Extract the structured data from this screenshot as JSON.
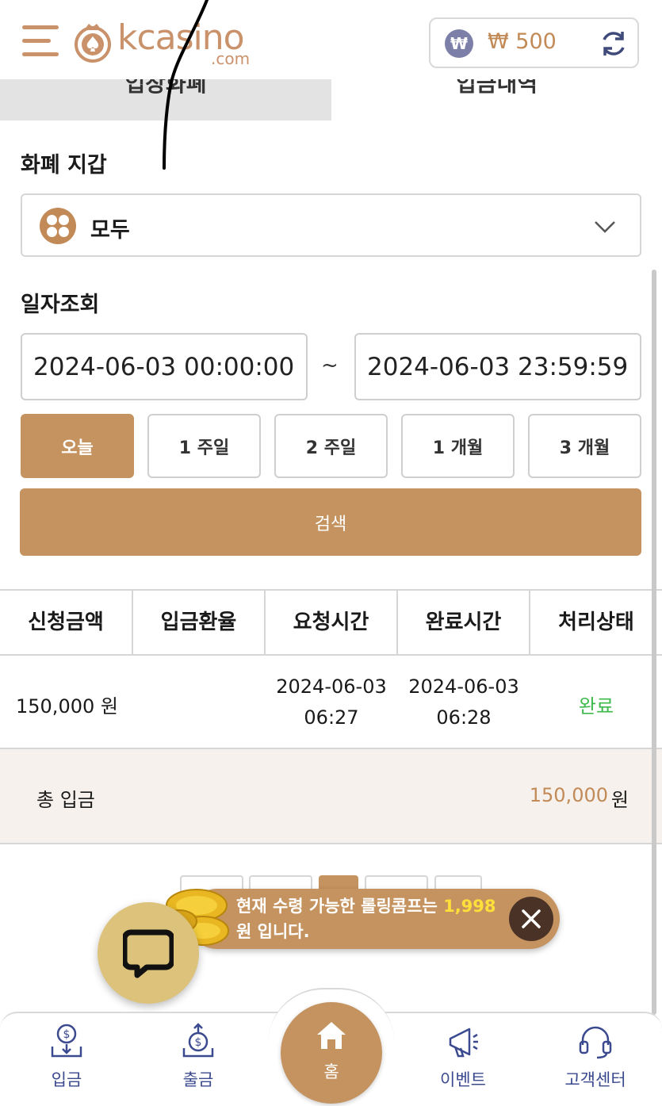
{
  "header": {
    "logo_text": "kcasino",
    "logo_sub": ".com",
    "balance": "₩ 500",
    "currency_symbol": "₩"
  },
  "tabs": [
    {
      "label": "입장화폐"
    },
    {
      "label": "입금내역"
    }
  ],
  "wallet": {
    "title": "화폐 지갑",
    "selected": "모두"
  },
  "date_filter": {
    "title": "일자조회",
    "start": "2024-06-03 00:00:00",
    "end": "2024-06-03 23:59:59",
    "separator": "~",
    "periods": [
      "오늘",
      "1 주일",
      "2 주일",
      "1 개월",
      "3 개월"
    ],
    "active_period": "오늘",
    "search_label": "검색"
  },
  "table": {
    "headers": [
      "신청금액",
      "입금환율",
      "요청시간",
      "완료시간",
      "처리상태"
    ],
    "rows": [
      {
        "amount": "150,000 원",
        "rate": "",
        "request_date": "2024-06-03",
        "request_time": "06:27",
        "complete_date": "2024-06-03",
        "complete_time": "06:28",
        "status": "완료"
      }
    ]
  },
  "total": {
    "label": "총 입금",
    "amount": "150,000",
    "unit": "원"
  },
  "toast": {
    "text_before": "현재 수령 가능한 롤링콤프는",
    "amount": "1,998",
    "text_after": "원 입니다."
  },
  "bottom_nav": {
    "deposit": "입금",
    "withdraw": "출금",
    "home": "홈",
    "event": "이벤트",
    "support": "고객센터"
  },
  "colors": {
    "accent": "#c4935f",
    "status_ok": "#3cb94a",
    "toast_amount": "#ffe03a",
    "nav_label": "#3b4a8f"
  }
}
